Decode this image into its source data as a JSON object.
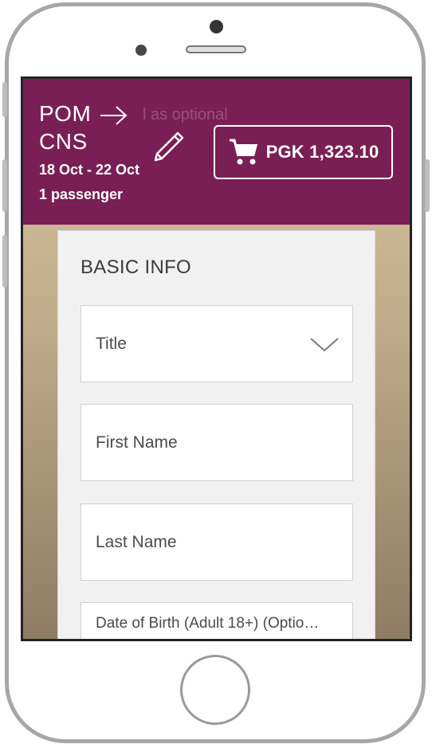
{
  "header": {
    "route_from": "POM",
    "route_to": "CNS",
    "dates": "18 Oct - 22 Oct",
    "passengers": "1 passenger",
    "ghost_text": "l as optional",
    "cart_total": "PGK 1,323.10",
    "background_color": "#7a1f55",
    "icons": {
      "arrow": "arrow-right-icon",
      "edit": "pencil-icon",
      "cart": "cart-icon"
    }
  },
  "form": {
    "section_title": "BASIC INFO",
    "title_select": {
      "placeholder": "Title",
      "icon": "chevron-down-icon"
    },
    "first_name": {
      "placeholder": "First Name"
    },
    "last_name": {
      "placeholder": "Last Name"
    },
    "dob": {
      "placeholder": "Date of Birth (Adult 18+) (Optio…"
    }
  }
}
